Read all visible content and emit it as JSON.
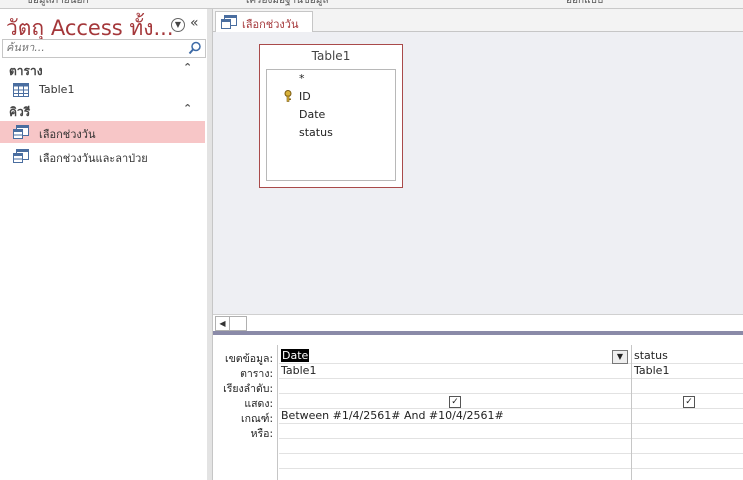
{
  "ribbon": {
    "labels": [
      "ข้อมูลภายนอก",
      "เครื่องมือฐานข้อมูล",
      "ออกแบบ"
    ]
  },
  "nav": {
    "title": "วัตถุ Access ทั้ง...",
    "search_placeholder": "ค้นหา...",
    "groups": [
      {
        "label": "ตาราง",
        "items": [
          {
            "label": "Table1",
            "icon": "table-icon"
          }
        ]
      },
      {
        "label": "คิวรี",
        "items": [
          {
            "label": "เลือกช่วงวัน",
            "icon": "query-icon",
            "selected": true
          },
          {
            "label": "เลือกช่วงวันและลาป่วย",
            "icon": "query-icon",
            "selected": false
          }
        ]
      }
    ]
  },
  "doc": {
    "tab_label": "เลือกช่วงวัน",
    "table_box": {
      "name": "Table1",
      "fields": [
        "*",
        "ID",
        "Date",
        "status"
      ]
    },
    "grid": {
      "row_labels": [
        "เขตข้อมูล:",
        "ตาราง:",
        "เรียงลำดับ:",
        "แสดง:",
        "เกณฑ์:",
        "หรือ:"
      ],
      "columns": [
        {
          "field": "Date",
          "table": "Table1",
          "sort": "",
          "show": true,
          "criteria": "Between #1/4/2561# And #10/4/2561#",
          "or": ""
        },
        {
          "field": "status",
          "table": "Table1",
          "sort": "",
          "show": true,
          "criteria": "",
          "or": ""
        }
      ]
    }
  },
  "colors": {
    "accent": "#a4373a",
    "selected_bg": "#f7c6c7",
    "design_bg": "#eeeff3"
  }
}
